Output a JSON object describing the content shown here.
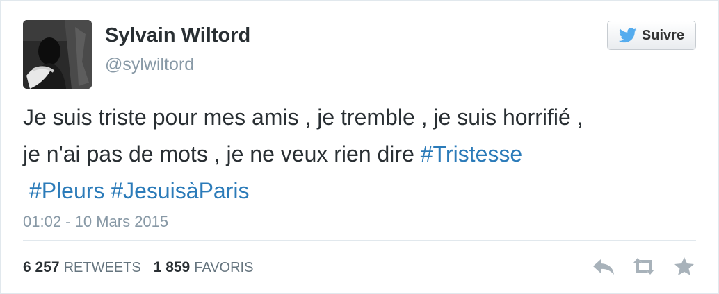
{
  "author": {
    "name": "Sylvain Wiltord",
    "handle": "@sylwiltord"
  },
  "follow_button": {
    "label": "Suivre",
    "icon": "twitter-bird-icon",
    "brand_color": "#55acee"
  },
  "tweet": {
    "line1": "Je suis triste pour mes amis , je tremble , je suis horrifié ,",
    "line2_text": "je n'ai pas de mots , je ne veux rien dire ",
    "hashtag1": "#Tristesse",
    "hashtag2": "#Pleurs",
    "hashtag3": "#JesuisàParis",
    "hashtag_color": "#2b7bb9"
  },
  "timestamp": "01:02 - 10 Mars 2015",
  "stats": {
    "retweets_count": "6 257",
    "retweets_label": "RETWEETS",
    "favorites_count": "1 859",
    "favorites_label": "FAVORIS"
  },
  "actions": {
    "reply_icon": "reply-icon",
    "retweet_icon": "retweet-icon",
    "favorite_icon": "star-icon",
    "icon_color": "#a8b2ba"
  }
}
